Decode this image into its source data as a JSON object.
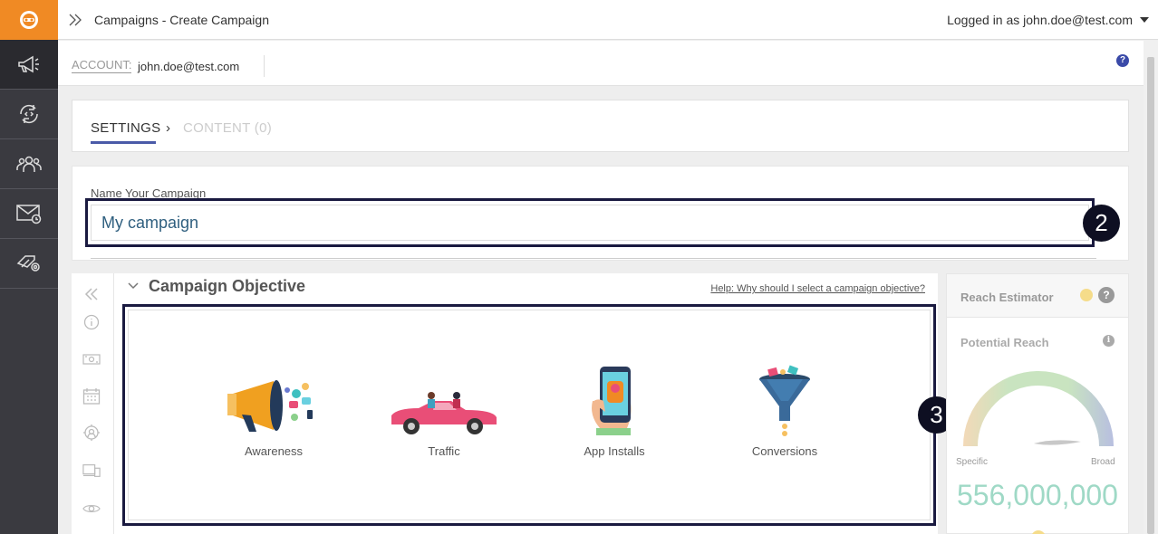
{
  "topbar": {
    "breadcrumb": "Campaigns - Create Campaign",
    "user": "Logged in as john.doe@test.com"
  },
  "account": {
    "label": "ACCOUNT:",
    "value": "john.doe@test.com"
  },
  "tabs": {
    "settings": "SETTINGS",
    "arrow": "›",
    "content": "CONTENT (0)"
  },
  "campaign_name": {
    "label": "Name Your Campaign",
    "value": "My campaign"
  },
  "badges": {
    "name": "2",
    "objective": "3"
  },
  "objective": {
    "title": "Campaign Objective",
    "help_link": "Help: Why should I select a campaign objective?",
    "options": [
      {
        "label": "Awareness",
        "icon": "megaphone-icon"
      },
      {
        "label": "Traffic",
        "icon": "car-icon"
      },
      {
        "label": "App Installs",
        "icon": "phone-icon"
      },
      {
        "label": "Conversions",
        "icon": "funnel-icon"
      }
    ]
  },
  "reach": {
    "title": "Reach Estimator",
    "potential_title": "Potential Reach",
    "specific": "Specific",
    "broad": "Broad",
    "value": "556,000,000"
  },
  "colors": {
    "brand_orange": "#f08a24",
    "nav_dark": "#3a3a40",
    "accent_blue": "#4a5aa8",
    "reach_number": "#9fd9c6"
  }
}
